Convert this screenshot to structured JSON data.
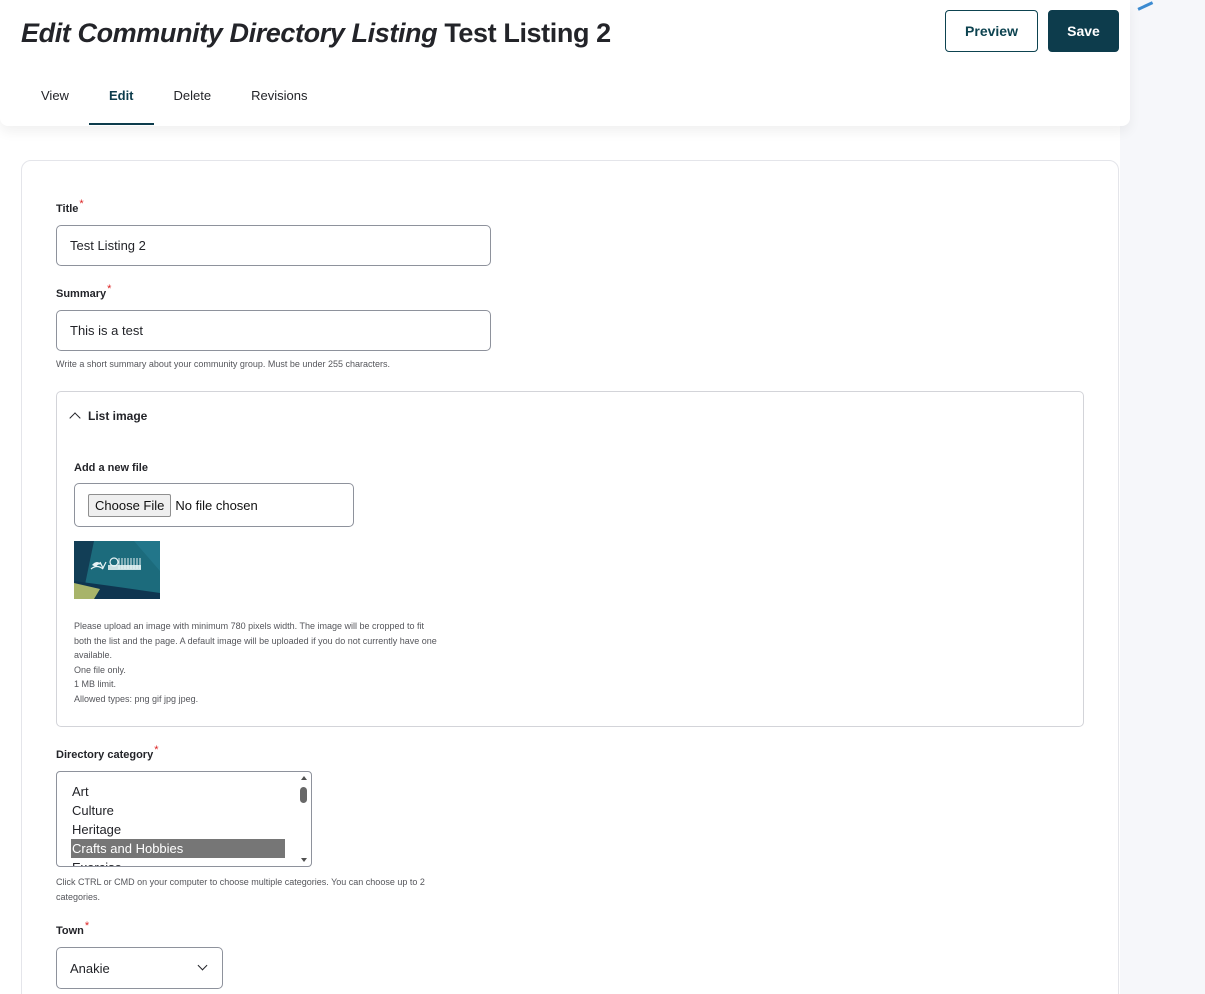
{
  "header": {
    "title_italic": "Edit Community Directory Listing",
    "title_rest": "Test Listing 2",
    "preview_label": "Preview",
    "save_label": "Save"
  },
  "tabs": [
    {
      "label": "View",
      "active": false
    },
    {
      "label": "Edit",
      "active": true
    },
    {
      "label": "Delete",
      "active": false
    },
    {
      "label": "Revisions",
      "active": false
    }
  ],
  "form": {
    "title": {
      "label": "Title",
      "required": "*",
      "value": "Test Listing 2"
    },
    "summary": {
      "label": "Summary",
      "required": "*",
      "value": "This is a test",
      "help": "Write a short summary about your community group. Must be under 255 characters."
    },
    "list_image": {
      "legend": "List image",
      "expanded": true,
      "add_label": "Add a new file",
      "choose_button": "Choose File",
      "file_status": "No file chosen",
      "thumbnail_caption": "GOLDEN PLAINS SHIRE",
      "help_lines": [
        "Please upload an image with minimum 780 pixels width. The image will be cropped to fit",
        "both the list and the page. A default image will be uploaded if you do not currently have one",
        "available.",
        "One file only.",
        "1 MB limit.",
        "Allowed types: png gif jpg jpeg."
      ]
    },
    "directory_category": {
      "label": "Directory category",
      "required": "*",
      "options": [
        "Art",
        "Culture",
        "Heritage",
        "Crafts and Hobbies",
        "Exercise"
      ],
      "selected": "Crafts and Hobbies",
      "help_lines": [
        "Click CTRL or CMD on your computer to choose multiple categories. You can choose up to 2",
        "categories."
      ]
    },
    "town": {
      "label": "Town",
      "required": "*",
      "value": "Anakie"
    }
  },
  "colors": {
    "brand_dark": "#0d3c4c",
    "required": "#dc2323",
    "selected_option": "#767676"
  }
}
